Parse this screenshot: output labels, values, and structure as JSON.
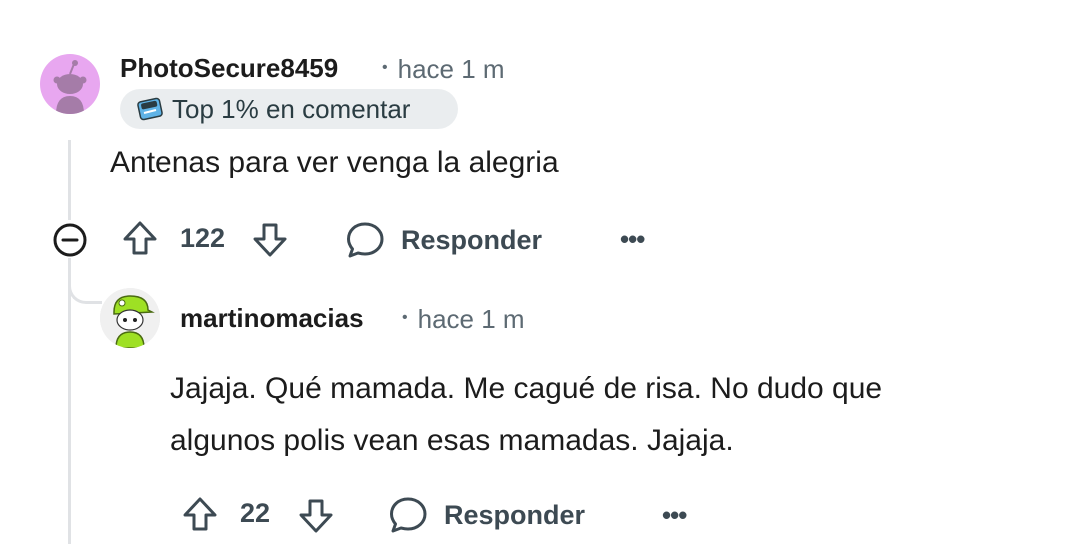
{
  "comment1": {
    "username": "PhotoSecure8459",
    "time": "hace 1 m",
    "flair": "Top 1% en comentar",
    "body": "Antenas para ver venga la alegria",
    "votes": "122",
    "reply_label": "Responder",
    "more": "•••"
  },
  "comment2": {
    "username": "martinomacias",
    "time": "hace 1 m",
    "body_line1": "Jajaja. Qué mamada. Me cagué de risa. No dudo que",
    "body_line2": "algunos polis vean esas mamadas. Jajaja.",
    "votes": "22",
    "reply_label": "Responder",
    "more": "•••"
  },
  "separator": "•",
  "colors": {
    "text": "#1c1c1c",
    "meta": "#5d6a73",
    "icon": "#3d4a53",
    "thread_line": "#e0e2e5",
    "flair_bg": "#eaedef",
    "avatar1_bg": "#e8a7f0",
    "avatar2_accent": "#9ee024"
  }
}
